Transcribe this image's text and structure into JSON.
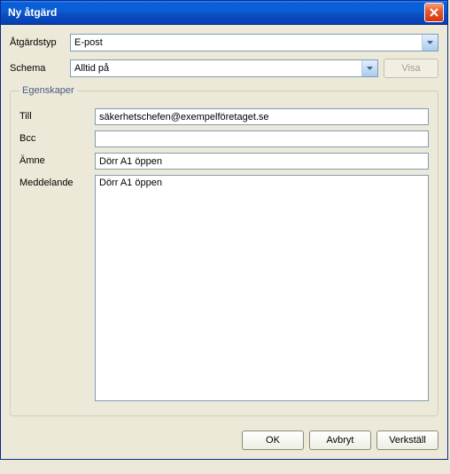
{
  "window": {
    "title": "Ny åtgärd"
  },
  "form": {
    "actionTypeLabel": "Åtgärdstyp",
    "actionTypeValue": "E-post",
    "scheduleLabel": "Schema",
    "scheduleValue": "Alltid på",
    "showButton": "Visa"
  },
  "properties": {
    "legend": "Egenskaper",
    "toLabel": "Till",
    "toValue": "säkerhetschefen@exempelföretaget.se",
    "bccLabel": "Bcc",
    "bccValue": "",
    "subjectLabel": "Ämne",
    "subjectValue": "Dörr A1 öppen",
    "messageLabel": "Meddelande",
    "messageValue": "Dörr A1 öppen"
  },
  "buttons": {
    "ok": "OK",
    "cancel": "Avbryt",
    "apply": "Verkställ"
  }
}
